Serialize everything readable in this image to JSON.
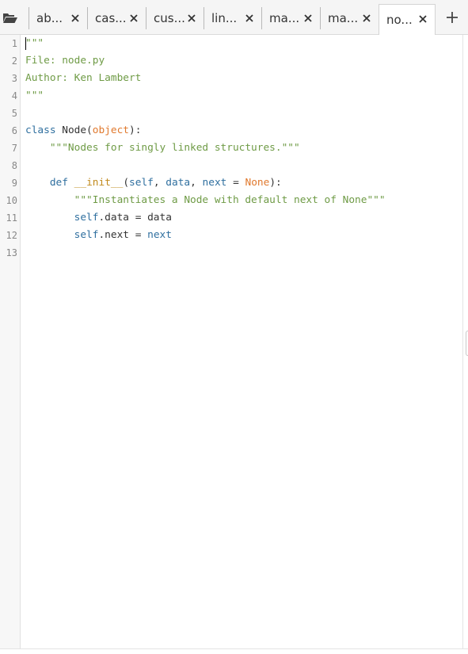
{
  "tabs": [
    {
      "label": "ab...",
      "active": false
    },
    {
      "label": "cas...",
      "active": false
    },
    {
      "label": "cus...",
      "active": false
    },
    {
      "label": "lin...",
      "active": false
    },
    {
      "label": "ma...",
      "active": false
    },
    {
      "label": "ma...",
      "active": false
    },
    {
      "label": "no...",
      "active": true
    }
  ],
  "icons": {
    "folder": "folder-open-icon",
    "close": "close-icon",
    "add": "plus-icon"
  },
  "line_numbers": [
    "1",
    "2",
    "3",
    "4",
    "5",
    "6",
    "7",
    "8",
    "9",
    "10",
    "11",
    "12",
    "13"
  ],
  "code": {
    "l1": "\"\"\"",
    "l2": "File: node.py",
    "l3": "Author: Ken Lambert",
    "l4": "\"\"\"",
    "l6_class": "class",
    "l6_name": " Node(",
    "l6_base": "object",
    "l6_end": "):",
    "l7": "    \"\"\"Nodes for singly linked structures.\"\"\"",
    "l9_indent": "    ",
    "l9_def": "def",
    "l9_sp": " ",
    "l9_init": "__init__",
    "l9_open": "(",
    "l9_self": "self",
    "l9_c1": ", ",
    "l9_data": "data",
    "l9_c2": ", ",
    "l9_next": "next",
    "l9_eq": " = ",
    "l9_none": "None",
    "l9_close": "):",
    "l10": "        \"\"\"Instantiates a Node with default next of None\"\"\"",
    "l11_indent": "        ",
    "l11_self": "self",
    "l11_attr": ".data = data",
    "l12_indent": "        ",
    "l12_self": "self",
    "l12_attr": ".next = ",
    "l12_val": "next"
  },
  "colors": {
    "string": "#6f9b46",
    "keyword": "#2f6f9f",
    "builtin": "#e0792e",
    "dunder": "#c18a1d",
    "text": "#333333"
  }
}
